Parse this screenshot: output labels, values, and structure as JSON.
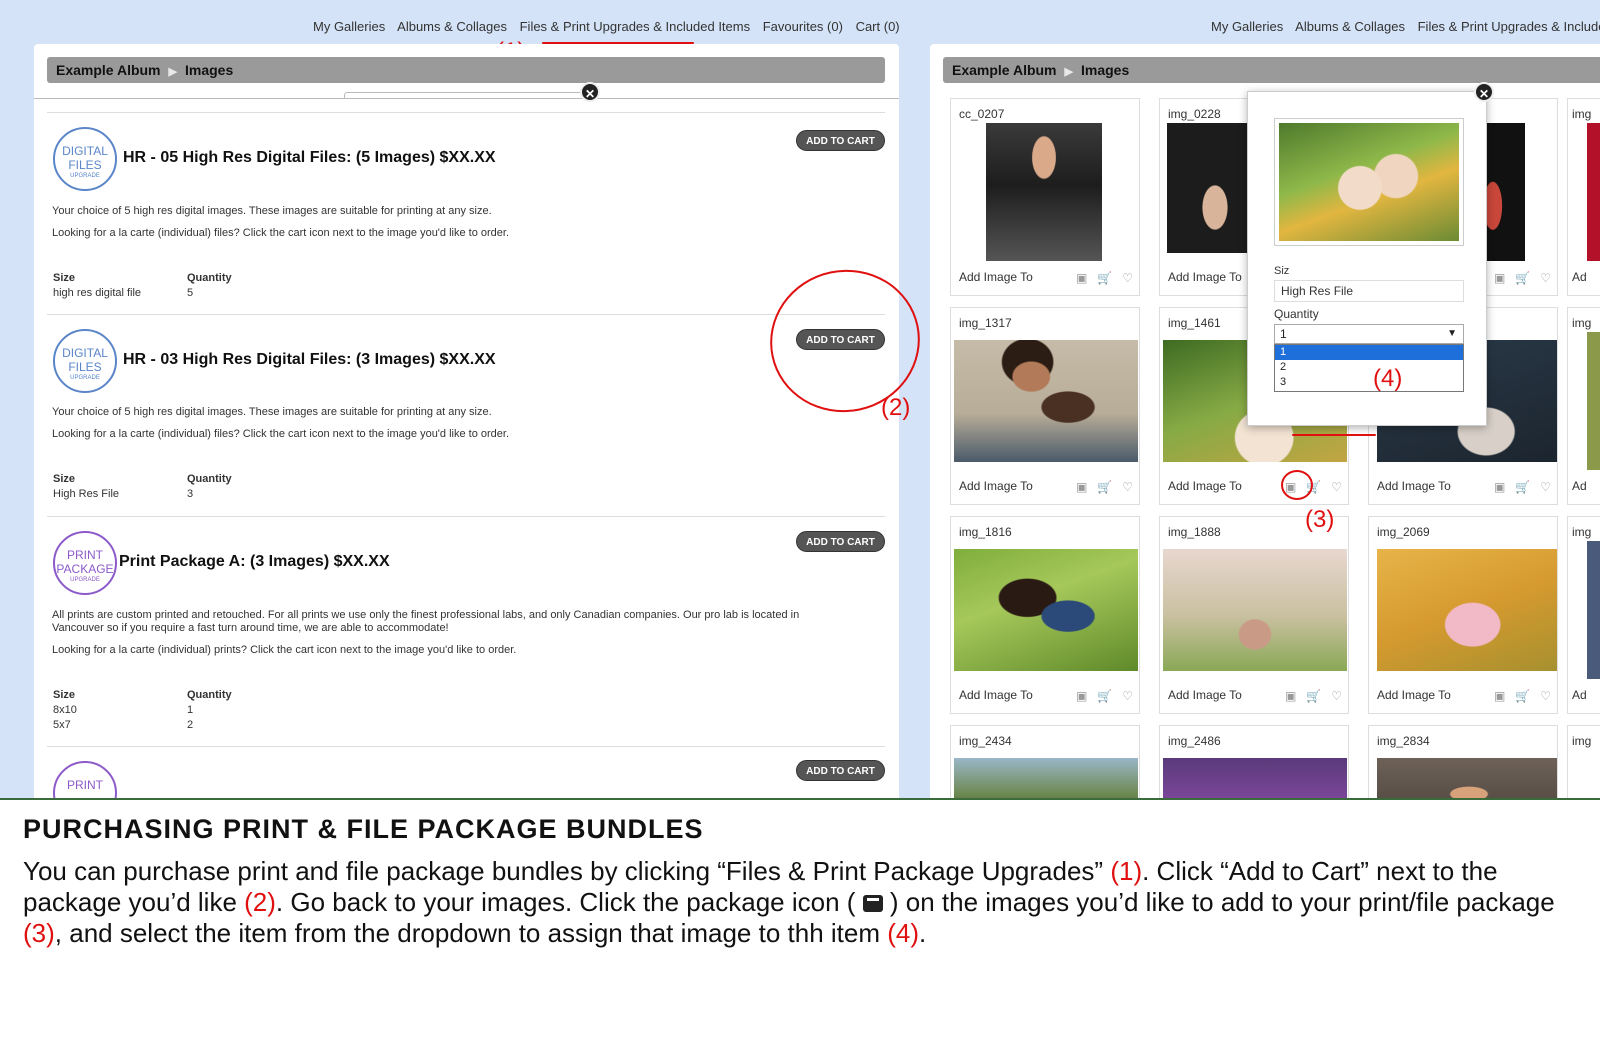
{
  "top_nav": {
    "items": [
      "My Galleries",
      "Albums & Collages",
      "Files & Print Upgrades & Included Items",
      "Favourites (0)",
      "Cart (0)"
    ]
  },
  "breadcrumb": {
    "album": "Example Album",
    "page": "Images"
  },
  "packages": [
    {
      "badge_top": "DIGITAL",
      "badge_mid": "FILES",
      "badge_bottom": "UPGRADE",
      "title": "HR - 05 High Res Digital Files: (5 Images) $XX.XX",
      "button": "ADD TO CART",
      "desc1": "Your choice of 5 high res digital images. These images are suitable for printing at any size.",
      "desc2": "Looking for a la carte (individual) files? Click the cart icon next to the image you'd like to order.",
      "size_label": "Size",
      "qty_label": "Quantity",
      "rows": [
        {
          "size": "high res digital file",
          "qty": "5"
        }
      ]
    },
    {
      "badge_top": "DIGITAL",
      "badge_mid": "FILES",
      "badge_bottom": "UPGRADE",
      "title": "HR - 03 High Res Digital Files: (3 Images) $XX.XX",
      "button": "ADD TO CART",
      "desc1": "Your choice of 5 high res digital images. These images are suitable for printing at any size.",
      "desc2": "Looking for a la carte (individual) files? Click the cart icon next to the image you'd like to order.",
      "size_label": "Size",
      "qty_label": "Quantity",
      "rows": [
        {
          "size": "High Res File",
          "qty": "3"
        }
      ]
    },
    {
      "badge_top": "PRINT",
      "badge_mid": "PACKAGE",
      "badge_bottom": "UPGRADE",
      "title": "Print Package A: (3 Images) $XX.XX",
      "button": "ADD TO CART",
      "desc1": "All prints are custom printed and retouched. For all prints we use only the finest professional labs, and only Canadian companies. Our pro lab is located in Vancouver so if you require a fast turn around time, we are able to accommodate!",
      "desc2": "Looking for a la carte (individual) prints? Click the cart icon next to the image you'd like to order.",
      "size_label": "Size",
      "qty_label": "Quantity",
      "rows": [
        {
          "size": "8x10",
          "qty": "1"
        },
        {
          "size": "5x7",
          "qty": "2"
        }
      ]
    },
    {
      "badge_top": "PRINT",
      "button": "ADD TO CART"
    }
  ],
  "gallery": {
    "add_label": "Add Image To",
    "tiles": [
      "cc_0207",
      "img_0228",
      "img_1317",
      "img_1461",
      "img_1816",
      "img_1888",
      "img_2069",
      "img_2434",
      "img_2486",
      "img_2834"
    ],
    "edge_tiles": [
      "img",
      "img",
      "img",
      "img"
    ],
    "edge_add": "Ad"
  },
  "popup": {
    "size_label": "Siz",
    "size_value": "High Res File",
    "qty_label": "Quantity",
    "qty_selected": "1",
    "qty_options": [
      "1",
      "2",
      "3"
    ]
  },
  "annotations": {
    "a1": "(1)",
    "a2": "(2)",
    "a3": "(3)",
    "a4": "(4)"
  },
  "caption": {
    "title": "PURCHASING PRINT & FILE PACKAGE BUNDLES",
    "p1": "You can purchase print and file package bundles by clicking “Files & Print Package Upgrades” ",
    "m1": "(1)",
    "p2": ". Click “Add to Cart” next to the package you’d like ",
    "m2": "(2)",
    "p3": ". Go back to your images. Click the package icon ( ",
    "p4": " ) on the images you’d like to add to your print/file package ",
    "m3": "(3)",
    "p5": ", and select the item from the dropdown to assign that image to thh item ",
    "m4": "(4)",
    "p6": "."
  },
  "colors": {
    "accent_red": "#e01010",
    "page_bg": "#d4e3f7",
    "crumb_bg": "#9a9a9a",
    "button_bg": "#555555"
  }
}
